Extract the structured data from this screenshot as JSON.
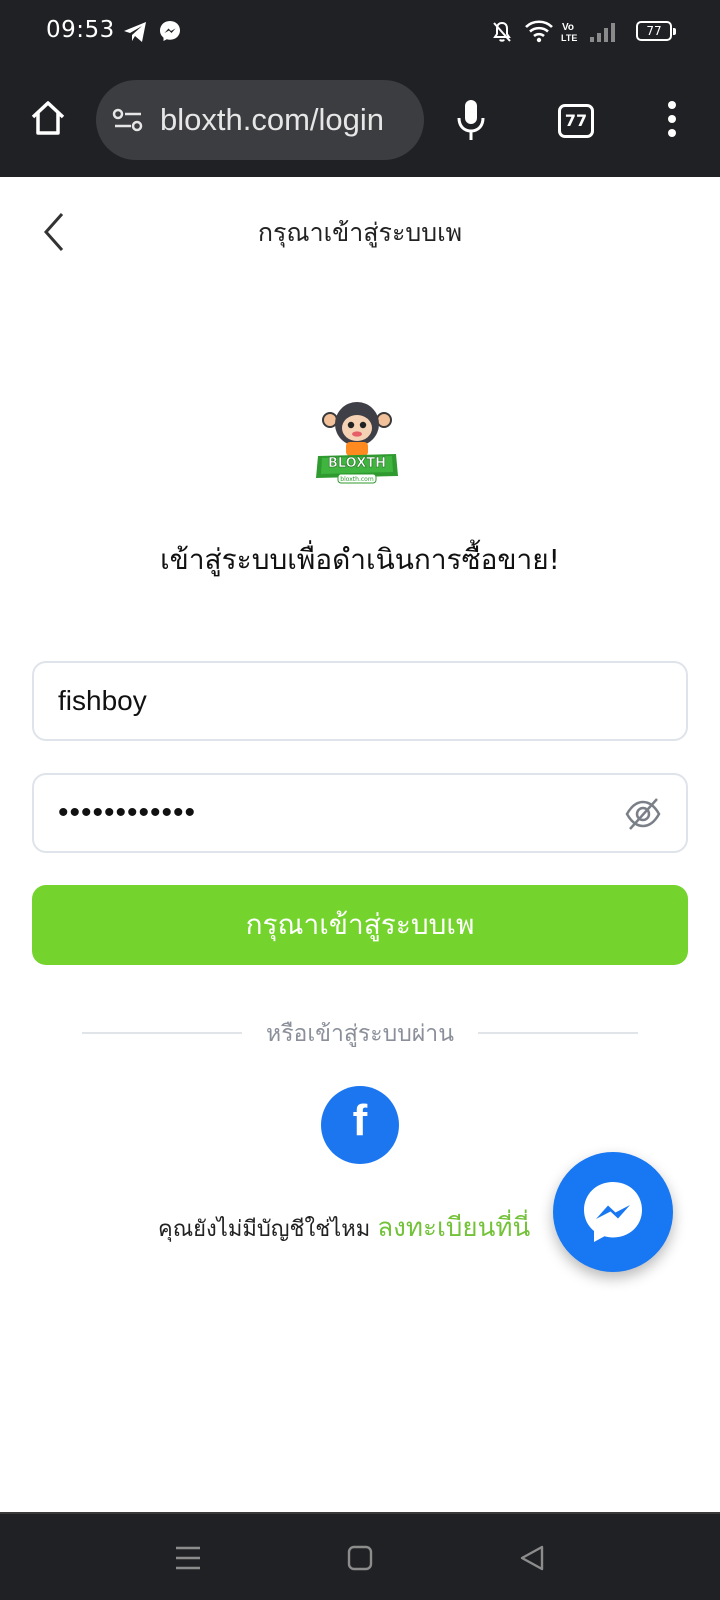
{
  "status_bar": {
    "time": "09:53",
    "battery": "77"
  },
  "browser": {
    "url": "bloxth.com/login",
    "tab_count": "77"
  },
  "header": {
    "title": "กรุณาเข้าสู่ระบบเพ"
  },
  "logo": {
    "brand": "BLOXTH",
    "domain": "bloxth.com"
  },
  "main": {
    "heading": "เข้าสู่ระบบเพื่อดำเนินการซื้อขาย!",
    "username_value": "fishboy",
    "password_value": "••••••••••••",
    "login_button": "กรุณาเข้าสู่ระบบเพ",
    "divider_text": "หรือเข้าสู่ระบบผ่าน",
    "facebook_glyph": "f",
    "register_prompt": "คุณยังไม่มีบัญชีใช่ไหม",
    "register_link": "ลงทะเบียนที่นี่"
  },
  "colors": {
    "accent_green": "#74d42d",
    "facebook_blue": "#1b76f0",
    "messenger_blue": "#1877f2",
    "chrome_dark": "#202124"
  }
}
